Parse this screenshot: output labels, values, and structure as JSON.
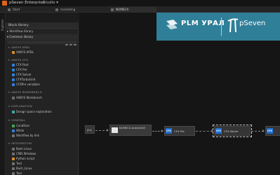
{
  "app": {
    "title": "pSeven Enterprise",
    "menu": "Studio ▾"
  },
  "tabs": [
    {
      "label": "Start"
    },
    {
      "label": "marketing"
    },
    {
      "label": "NUMECA"
    }
  ],
  "explorer": {
    "label": "Explorer"
  },
  "library": {
    "header": "Block library",
    "workflow_library": "▸ Workflow library",
    "common_library": "▾ Common library",
    "sections": [
      {
        "title": "ANSYS APDL",
        "items": [
          {
            "label": "ANSYS APDL",
            "icon": "ansys-icon"
          }
        ]
      },
      {
        "title": "ANSYS CFX",
        "items": [
          {
            "label": "CFX Post",
            "icon": "cfx-icon"
          },
          {
            "label": "CFX Pre",
            "icon": "cfx-icon"
          },
          {
            "label": "CFX Solver",
            "icon": "cfx-icon"
          },
          {
            "label": "CFXTurboGrid",
            "icon": "cfx-icon"
          },
          {
            "label": "CFXPre variables",
            "icon": "cfx-icon"
          }
        ]
      },
      {
        "title": "ANSYS WORKBENCH",
        "items": [
          {
            "label": "ANSYS Workbench",
            "icon": "workbench-icon"
          }
        ]
      },
      {
        "title": "EXPLORATION",
        "items": [
          {
            "label": "Design space exploration",
            "icon": "exploration-icon"
          }
        ]
      },
      {
        "title": "GENERAL",
        "items": [
          {
            "label": "Condition",
            "icon": "condition-icon"
          },
          {
            "label": "While",
            "icon": "while-icon"
          },
          {
            "label": "Workflow by link",
            "icon": "link-icon"
          }
        ]
      },
      {
        "title": "INTEGRATION",
        "items": [
          {
            "label": "Bash Linux",
            "icon": "bash-icon"
          },
          {
            "label": "CMD Windows",
            "icon": "cmd-icon"
          },
          {
            "label": "Python script",
            "icon": "python-icon"
          },
          {
            "label": "Text",
            "icon": "text-icon"
          },
          {
            "label": "Bash_Linux",
            "icon": "bash-icon"
          },
          {
            "label": "Text",
            "icon": "text-icon"
          }
        ]
      }
    ]
  },
  "brand": {
    "left": "PLM УРАЛ",
    "right": "pSeven"
  },
  "workflow": {
    "nodes": [
      {
        "label": "[in]"
      },
      {
        "label": "NUMECA AutoGrid5"
      },
      {
        "label": "CFX Pre",
        "badge": "CFX"
      },
      {
        "label": "CFX Solver",
        "badge": "CFX"
      },
      {
        "label": "",
        "badge": "CFX"
      }
    ]
  }
}
